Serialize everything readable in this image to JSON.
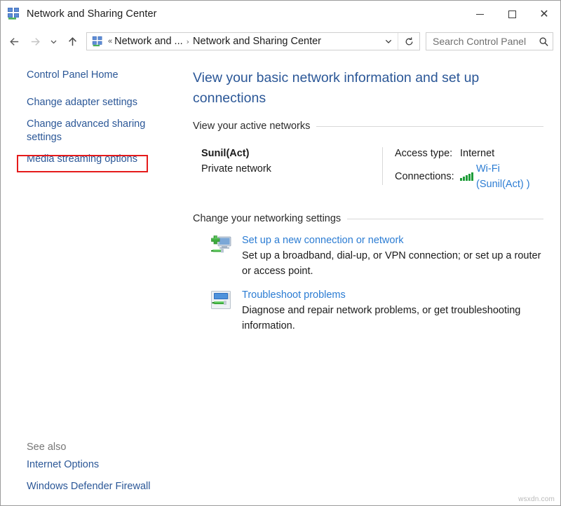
{
  "window": {
    "title": "Network and Sharing Center",
    "icon": "network-sharing-center-icon",
    "caption": {
      "minimize_label": "Minimize",
      "maximize_label": "Maximize",
      "close_label": "Close"
    }
  },
  "navbar": {
    "back_label": "Back",
    "forward_label": "Forward",
    "recent_label": "Recent locations",
    "up_label": "Up",
    "breadcrumb": {
      "overflow": "«",
      "items": [
        "Network and ...",
        "Network and Sharing Center"
      ],
      "separator": "›"
    },
    "dropdown_label": "Previous locations",
    "refresh_label": "Refresh",
    "search": {
      "placeholder": "Search Control Panel",
      "value": ""
    }
  },
  "sidebar": {
    "items": [
      {
        "label": "Control Panel Home",
        "highlighted": false
      },
      {
        "label": "Change adapter settings",
        "highlighted": true
      },
      {
        "label": "Change advanced sharing settings",
        "highlighted": false
      },
      {
        "label": "Media streaming options",
        "highlighted": false
      }
    ],
    "see_also": {
      "title": "See also",
      "items": [
        {
          "label": "Internet Options"
        },
        {
          "label": "Windows Defender Firewall"
        }
      ]
    },
    "highlight_color": "#e51b1b"
  },
  "main": {
    "page_title": "View your basic network information and set up connections",
    "active_networks": {
      "section_label": "View your active networks",
      "network_name": "Sunil(Act)",
      "network_type": "Private network",
      "details": [
        {
          "key": "Access type:",
          "value": "Internet",
          "is_link": false,
          "icon": null
        },
        {
          "key": "Connections:",
          "value": "Wi-Fi (Sunil(Act) )",
          "is_link": true,
          "icon": "wifi-signal-icon"
        }
      ]
    },
    "change_settings": {
      "section_label": "Change your networking settings",
      "tasks": [
        {
          "icon": "new-connection-icon",
          "link": "Set up a new connection or network",
          "description": "Set up a broadband, dial-up, or VPN connection; or set up a router or access point."
        },
        {
          "icon": "troubleshoot-icon",
          "link": "Troubleshoot problems",
          "description": "Diagnose and repair network problems, or get troubleshooting information."
        }
      ]
    }
  },
  "watermark": "wsxdn.com",
  "colors": {
    "link_blue": "#2b7cd3",
    "heading_blue": "#2b5797",
    "highlight_red": "#e51b1b",
    "signal_green": "#1f9d3a"
  }
}
